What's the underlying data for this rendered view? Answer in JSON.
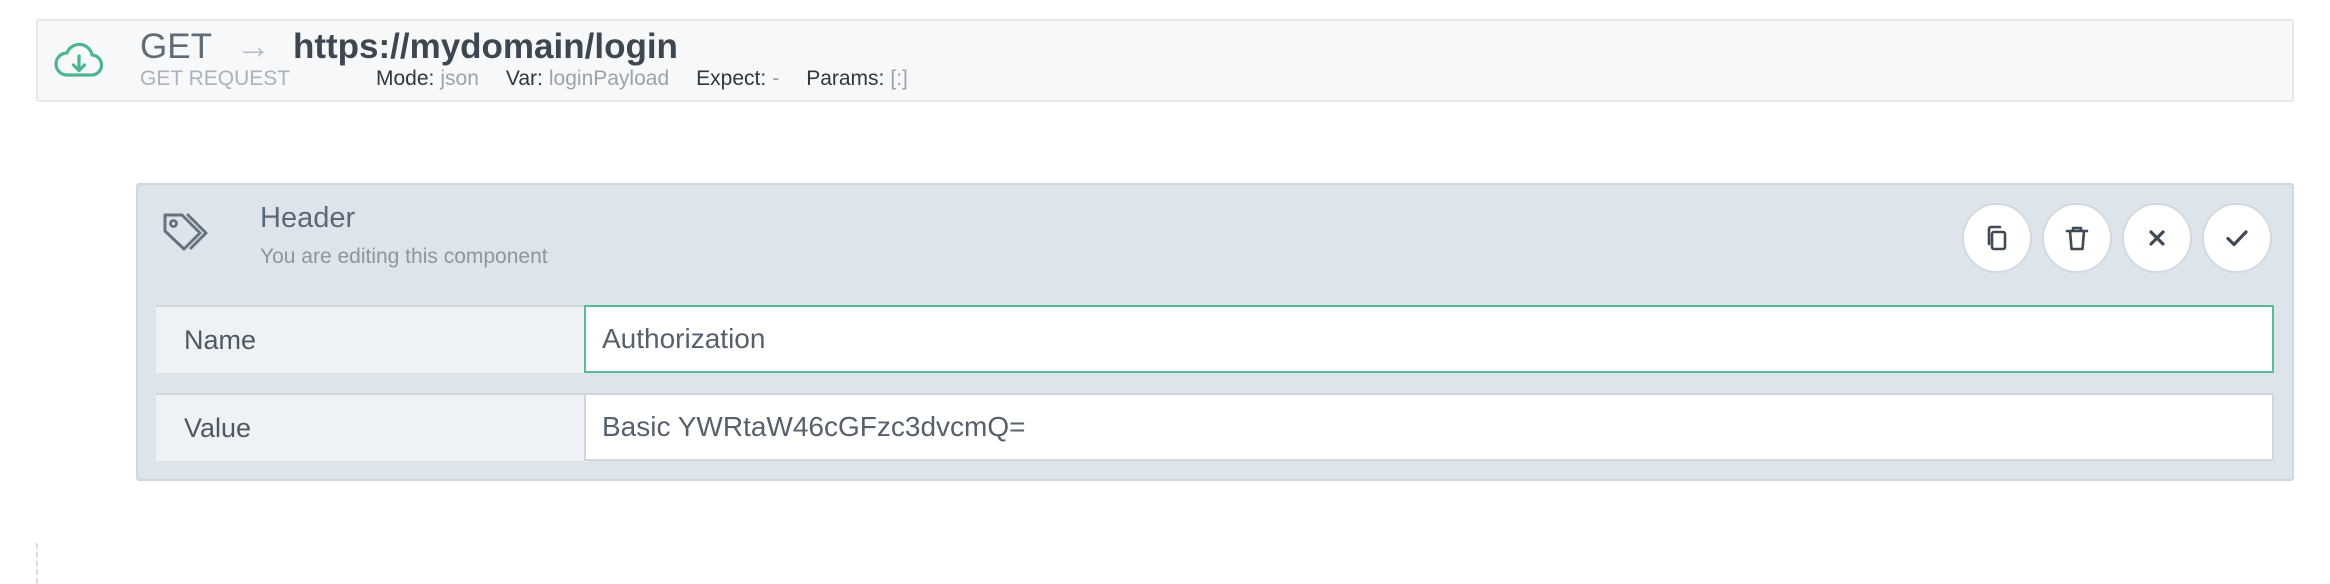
{
  "request": {
    "method": "GET",
    "arrow": "→",
    "url": "https://mydomain/login",
    "type_label": "GET REQUEST",
    "mode_label": "Mode:",
    "mode_value": "json",
    "var_label": "Var:",
    "var_value": "loginPayload",
    "expect_label": "Expect:",
    "expect_value": "-",
    "params_label": "Params:",
    "params_value": "[:]",
    "icon": "cloud-download-icon",
    "icon_color": "#4db58f"
  },
  "component": {
    "title": "Header",
    "subtitle": "You are editing this component",
    "icon": "tags-icon",
    "actions": [
      {
        "name": "copy",
        "icon": "copy-icon"
      },
      {
        "name": "delete",
        "icon": "trash-icon"
      },
      {
        "name": "cancel",
        "icon": "close-icon"
      },
      {
        "name": "confirm",
        "icon": "check-icon"
      }
    ],
    "fields": {
      "name_label": "Name",
      "name_value": "Authorization",
      "value_label": "Value",
      "value_value": "Basic YWRtaW46cGFzc3dvcmQ="
    }
  },
  "colors": {
    "accent": "#59bb97",
    "panel_bg": "#dde4eb",
    "text_dark": "#3d4751"
  }
}
